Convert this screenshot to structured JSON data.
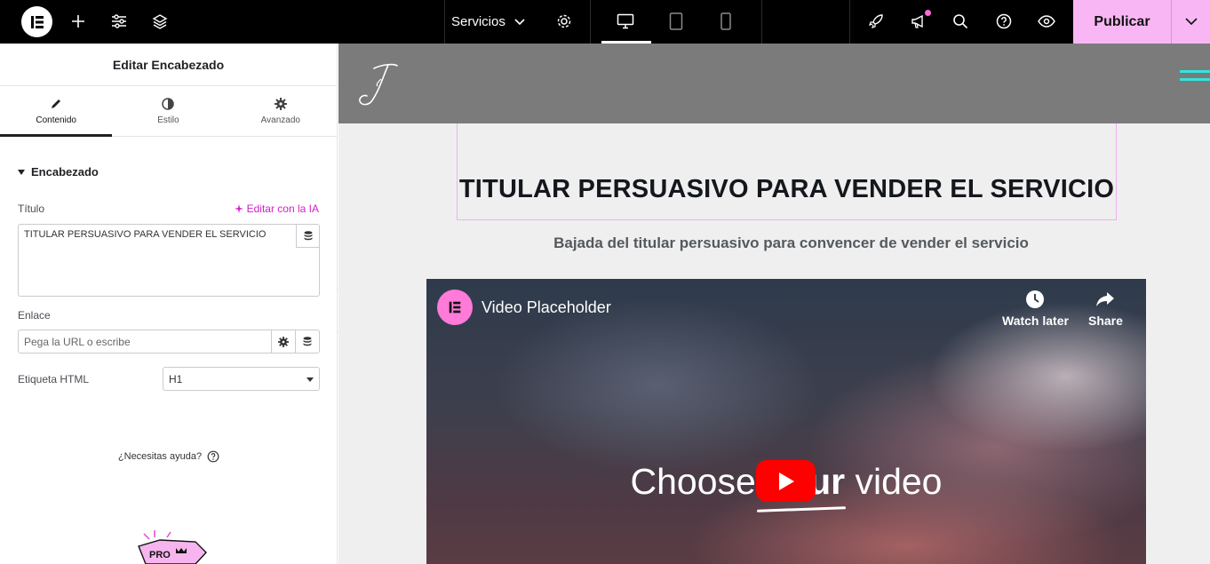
{
  "topbar": {
    "page_selector": "Servicios",
    "publish_label": "Publicar"
  },
  "panel": {
    "title": "Editar Encabezado",
    "tabs": [
      {
        "label": "Contenido",
        "icon": "pencil-icon"
      },
      {
        "label": "Estilo",
        "icon": "contrast-icon"
      },
      {
        "label": "Avanzado",
        "icon": "gear-icon"
      }
    ],
    "section_title": "Encabezado",
    "title_field": {
      "label": "Título",
      "ai_link": "Editar con la IA",
      "value": "TITULAR PERSUASIVO PARA VENDER EL SERVICIO"
    },
    "link_field": {
      "label": "Enlace",
      "placeholder": "Pega la URL o escribe"
    },
    "html_tag": {
      "label": "Etiqueta HTML",
      "value": "H1"
    },
    "help_label": "¿Necesitas ayuda?",
    "promo_text": "PRO"
  },
  "canvas": {
    "heading": "TITULAR PERSUASIVO PARA VENDER EL SERVICIO",
    "subheading": "Bajada del titular persuasivo para convencer de vender el servicio",
    "video": {
      "title": "Video Placeholder",
      "watch_later": "Watch later",
      "share": "Share",
      "overlay_text_a": "Choose ",
      "overlay_text_b": "your",
      "overlay_text_c": " video"
    }
  }
}
